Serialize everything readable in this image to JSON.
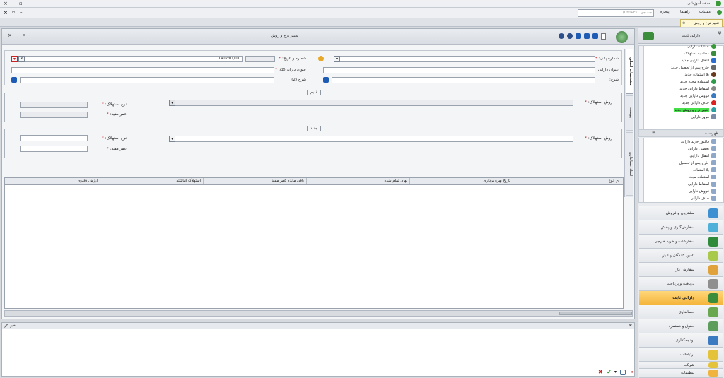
{
  "titlebar": {
    "title": "نسخه آموزشی",
    "min": "–",
    "max": "▫",
    "close": "×"
  },
  "menubar": {
    "items": [
      "عملیات",
      "راهنما",
      "پنجره"
    ],
    "search_placeholder": "جستجو... (Ctrl+F)"
  },
  "tab": {
    "label": "تغییر نرخ و روش"
  },
  "doc": {
    "title": "تغییر نرخ و روش",
    "fields": {
      "plaque_label": "شماره پلاک:",
      "number_date_label": "شماره و تاریخ:",
      "date_value": "1402/01/01",
      "asset_title_label": "عنوان دارایی:",
      "asset_title2_label": "عنوان دارایی(2):",
      "description_label": "شرح:",
      "description2_label": "شرح (2):"
    },
    "old_section": {
      "title": "قدیم",
      "method_label": "روش استهلاک:",
      "rate_label": "نرخ استهلاک:",
      "life_label": "عمر مفید:"
    },
    "new_section": {
      "title": "جدید",
      "method_label": "روش استهلاک:",
      "rate_label": "نرخ استهلاک:",
      "life_label": "عمر مفید:"
    },
    "grid_columns": [
      "نوع",
      "تاریخ بهره برداری",
      "بهای تمام شده",
      "باقی مانده عمر مفید",
      "استهلاک انباشته",
      "ارزش دفتری"
    ],
    "side_tabs": [
      "مشخصات اصلی",
      "پیوست",
      "اسناد حسابداری"
    ]
  },
  "footer": {
    "label": "خبر کار",
    "pin": "ψ"
  },
  "sidebar": {
    "header": "دارایی ثابت",
    "ops": [
      "عملیات دارایی",
      "محاسبه استهلاک",
      "انتقال دارایی جدید",
      "خارج پس از تحصیل جدید",
      "بلا استفاده جدید",
      "استفاده مجدد جدید",
      "اسقاط دارایی جدید",
      "فروش دارایی جدید",
      "حذف دارایی جدید",
      "تغییر نرخ و روش جدید",
      "مرور دارایی"
    ],
    "list_header": "فهرست",
    "lists": [
      "فاکتور خرید دارایی",
      "تحصیل دارایی",
      "انتقال دارایی",
      "خارج پس از تحصیل",
      "بلا استفاده",
      "استفاده مجدد",
      "اسقاط دارایی",
      "فروش دارایی",
      "حذف دارایی"
    ],
    "modules": [
      "مشتریان و فروش",
      "سفارش‌گیری و پخش",
      "سفارشات و خرید خارجی",
      "تامین کنندگان و انبار",
      "سفارش کار",
      "دریافت و پرداخت",
      "دارایی ثابت",
      "حسابداری",
      "حقوق و دستمزد",
      "بودجه‌گذاری",
      "ارتباطات",
      "شرکت",
      "تنظیمات"
    ],
    "active_module": "دارایی ثابت"
  },
  "colors": {
    "accent": "#f5b53b",
    "highlight": "#45e04a",
    "header_bg": "#d9dde3"
  }
}
